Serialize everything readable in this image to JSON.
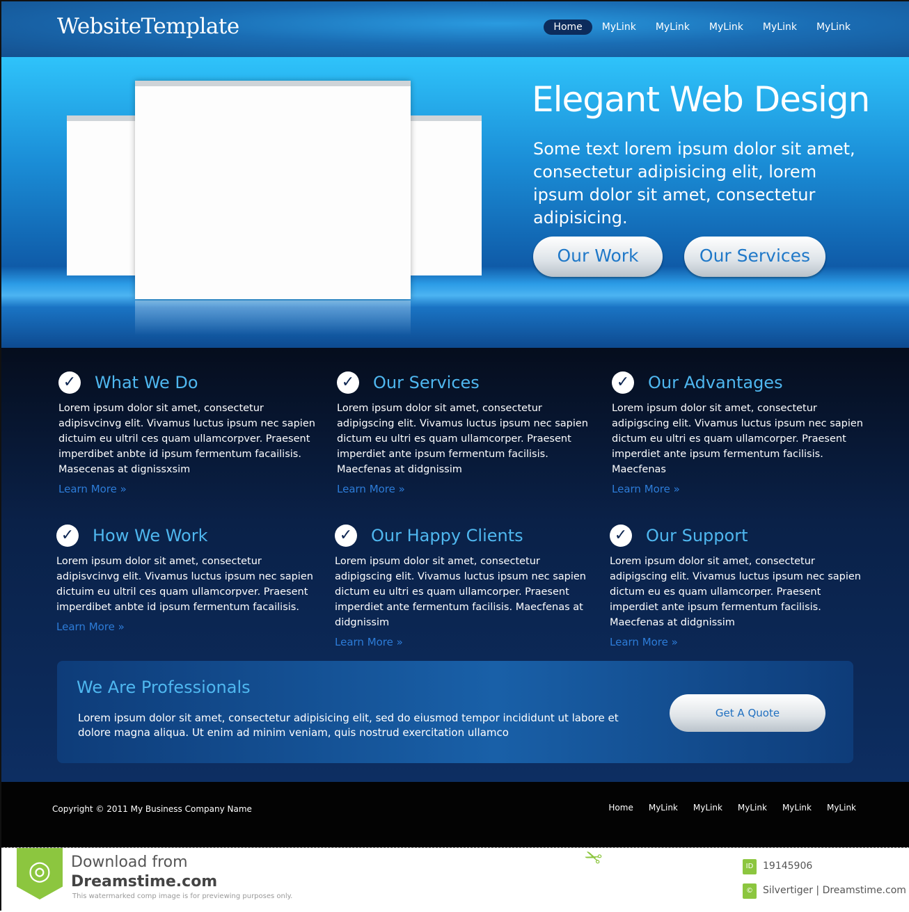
{
  "header": {
    "logo": "WebsiteTemplate",
    "nav": [
      "Home",
      "MyLink",
      "MyLink",
      "MyLink",
      "MyLink",
      "MyLink"
    ],
    "active": "Home"
  },
  "hero": {
    "title": "Elegant Web Design",
    "text": "Some text lorem ipsum dolor sit amet, consectetur adipisicing elit, lorem ipsum dolor sit amet, consectetur adipisicing.",
    "buttons": [
      "Our Work",
      "Our Services"
    ]
  },
  "features": [
    {
      "title": "What We Do",
      "text": "Lorem ipsum dolor sit amet, consectetur adipisvcinvg elit. Vivamus luctus ipsum nec sapien dictuim eu ultril ces quam ullamcorpver. Praesent imperdibet anbte id ipsum fermentum facailisis. Masecenas at dignissxsim",
      "link": "Learn More »"
    },
    {
      "title": "Our Services",
      "text": "Lorem ipsum dolor sit amet, consectetur adipigscing elit. Vivamus luctus ipsum nec sapien dictum eu ultri es quam ullamcorper. Praesent imperdiet ante ipsum fermentum facilisis. Maecfenas at didgnissim",
      "link": "Learn More »"
    },
    {
      "title": "Our Advantages",
      "text": "Lorem ipsum dolor sit amet, consectetur adipigscing elit. Vivamus luctus ipsum nec sapien dictum eu ultri es quam ullamcorper. Praesent imperdiet ante ipsum fermentum facilisis. Maecfenas",
      "link": "Learn More »"
    },
    {
      "title": "How We Work",
      "text": "Lorem ipsum dolor sit amet, consectetur adipisvcinvg elit. Vivamus luctus ipsum nec sapien dictuim eu ultril ces quam ullamcorpver. Praesent imperdibet anbte id ipsum fermentum facailisis.",
      "link": "Learn More »"
    },
    {
      "title": "Our Happy Clients",
      "text": "Lorem ipsum dolor sit amet, consectetur adipigscing elit. Vivamus luctus ipsum nec sapien dictum eu ultri es quam ullamcorper. Praesent imperdiet ante fermentum facilisis. Maecfenas at didgnissim",
      "link": "Learn More »"
    },
    {
      "title": "Our Support",
      "text": "Lorem ipsum dolor sit amet, consectetur adipigscing elit. Vivamus luctus ipsum nec sapien dictum eu es quam ullamcorper. Praesent imperdiet ante ipsum fermentum facilisis. Maecfenas at didgnissim",
      "link": "Learn More »"
    }
  ],
  "professionals": {
    "title": "We Are Professionals",
    "text": "Lorem ipsum dolor sit amet, consectetur adipisicing elit, sed do eiusmod tempor incididunt ut labore et dolore magna aliqua. Ut enim ad minim veniam, quis nostrud exercitation ullamco",
    "button": "Get A Quote"
  },
  "footer": {
    "copyright": "Copyright © 2011 My Business Company Name",
    "nav": [
      "Home",
      "MyLink",
      "MyLink",
      "MyLink",
      "MyLink",
      "MyLink"
    ]
  },
  "watermark": {
    "line1": "Download from",
    "line2": "Dreamstime.com",
    "line3": "This watermarked comp image is for previewing purposes only.",
    "id_label": "ID",
    "id": "19145906",
    "credit_icon": "©",
    "credit": "Silvertiger | Dreamstime.com"
  },
  "colors": {
    "accent": "#4fb7ef",
    "link": "#2d7cd8",
    "brand_green": "#8cc63f"
  }
}
